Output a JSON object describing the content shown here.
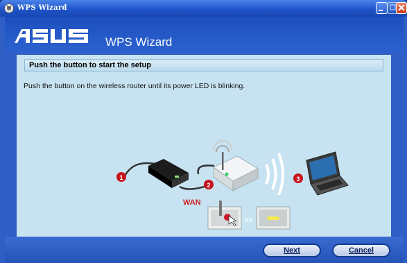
{
  "window": {
    "title": "WPS Wizard",
    "app_icon": "asus-wps-icon",
    "controls": [
      "minimize-icon",
      "maximize-icon",
      "close-icon"
    ]
  },
  "header": {
    "brand": "ASUS",
    "title": "WPS Wizard"
  },
  "step": {
    "heading": "Push the button to start the setup",
    "instruction": "Push the button on the wireless router until its power LED is blinking."
  },
  "illustration": {
    "markers": [
      "1",
      "2",
      "3"
    ],
    "port_label": "WAN",
    "arrow_text": ">>",
    "items": [
      "modem-icon",
      "router-icon",
      "laptop-icon",
      "wps-button-icon",
      "led-indicator-icon"
    ]
  },
  "footer": {
    "next_label": "Next",
    "cancel_label": "Cancel"
  },
  "colors": {
    "title_bar": "#1f55c9",
    "content_bg": "#c7e3f1",
    "marker": "#c8141e",
    "wan_label": "#d02020"
  }
}
